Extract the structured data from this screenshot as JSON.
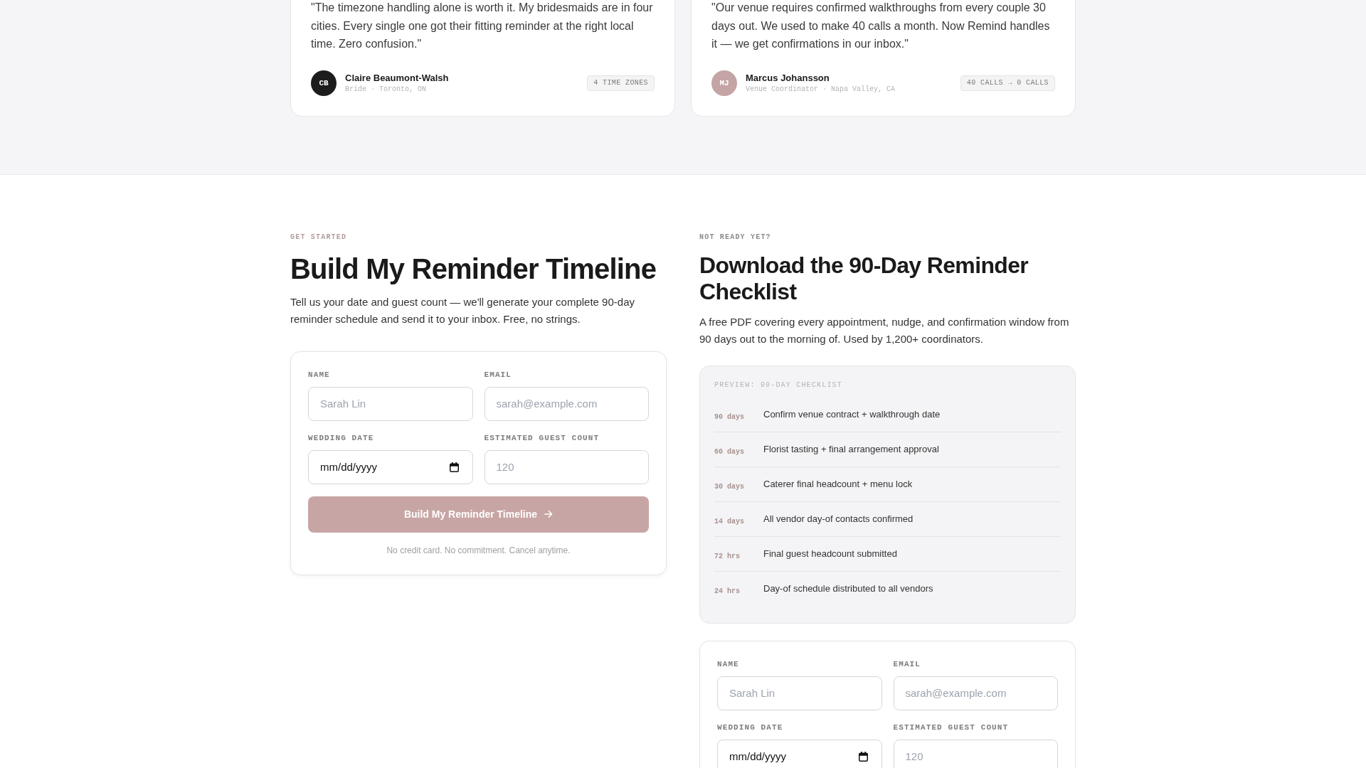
{
  "testimonials": [
    {
      "quote": "\"The timezone handling alone is worth it. My bridesmaids are in four cities. Every single one got their fitting reminder at the right local time. Zero confusion.\"",
      "initials": "CB",
      "color": "#1c1c1c",
      "name": "Claire Beaumont-Walsh",
      "role": "Bride · Toronto, ON",
      "badge": "4 TIME ZONES"
    },
    {
      "quote": "\"Our venue requires confirmed walkthroughs from every couple 30 days out. We used to make 40 calls a month. Now Remind handles it — we get confirmations in our inbox.\"",
      "initials": "MJ",
      "color": "#c4a4a4",
      "name": "Marcus Johansson",
      "role": "Venue Coordinator · Napa Valley, CA",
      "badge": "40 CALLS → 0 CALLS"
    }
  ],
  "get_started": {
    "eyebrow": "GET STARTED",
    "heading": "Build My Reminder Timeline",
    "text": "Tell us your date and guest count — we'll generate your complete 90-day reminder schedule and send it to your inbox. Free, no strings.",
    "form": {
      "fields": [
        {
          "kind": "text",
          "label": "NAME",
          "placeholder": "Sarah Lin"
        },
        {
          "kind": "email",
          "label": "EMAIL",
          "placeholder": "sarah@example.com"
        },
        {
          "kind": "date",
          "label": "WEDDING DATE",
          "placeholder": "mm/dd/yyyy"
        },
        {
          "kind": "number",
          "label": "ESTIMATED GUEST COUNT",
          "placeholder": "120"
        }
      ],
      "button": "Build My Reminder Timeline",
      "note": "No credit card. No commitment. Cancel anytime."
    }
  },
  "checklist_offer": {
    "eyebrow": "NOT READY YET?",
    "heading": "Download the 90-Day Reminder Checklist",
    "text": "A free PDF covering every appointment, nudge, and confirmation window from 90 days out to the morning of. Used by 1,200+ coordinators.",
    "preview": {
      "title": "PREVIEW: 90-DAY CHECKLIST",
      "items": [
        {
          "when": "90 days",
          "task": "Confirm venue contract + walkthrough date"
        },
        {
          "when": "60 days",
          "task": "Florist tasting + final arrangement approval"
        },
        {
          "when": "30 days",
          "task": "Caterer final headcount + menu lock"
        },
        {
          "when": "14 days",
          "task": "All vendor day-of contacts confirmed"
        },
        {
          "when": "72 hrs",
          "task": "Final guest headcount submitted"
        },
        {
          "when": "24 hrs",
          "task": "Day-of schedule distributed to all vendors"
        }
      ]
    },
    "form": {
      "fields": [
        {
          "kind": "text",
          "label": "NAME",
          "placeholder": "Sarah Lin"
        },
        {
          "kind": "email",
          "label": "EMAIL",
          "placeholder": "sarah@example.com"
        },
        {
          "kind": "date",
          "label": "WEDDING DATE",
          "placeholder": "mm/dd/yyyy"
        },
        {
          "kind": "number",
          "label": "ESTIMATED GUEST COUNT",
          "placeholder": "120"
        }
      ]
    }
  }
}
